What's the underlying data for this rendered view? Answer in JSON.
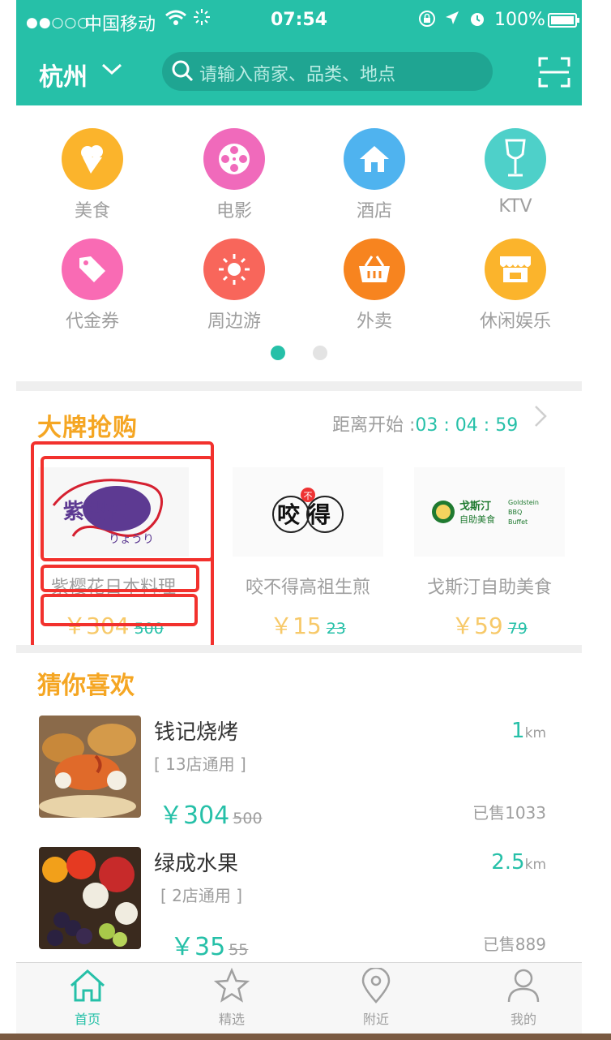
{
  "status_bar": {
    "signal": "●●○○○",
    "carrier": "中国移动",
    "time": "07:54",
    "battery": "100%"
  },
  "header": {
    "city": "杭州",
    "search_placeholder": "请输入商家、品类、地点"
  },
  "categories": [
    {
      "label": "美食",
      "color": "#fbb42c",
      "icon": "ice-cream-icon"
    },
    {
      "label": "电影",
      "color": "#f06abb",
      "icon": "film-reel-icon"
    },
    {
      "label": "酒店",
      "color": "#4fb3ef",
      "icon": "house-icon"
    },
    {
      "label": "KTV",
      "color": "#4ed0c9",
      "icon": "wine-glass-icon"
    },
    {
      "label": "代金券",
      "color": "#f96bb4",
      "icon": "tag-icon"
    },
    {
      "label": "周边游",
      "color": "#f8665b",
      "icon": "sun-icon"
    },
    {
      "label": "外卖",
      "color": "#f7841f",
      "icon": "basket-icon"
    },
    {
      "label": "休闲娱乐",
      "color": "#fbb42c",
      "icon": "shop-icon"
    }
  ],
  "colors": {
    "brand": "#26c0a8",
    "accent_orange": "#f5a623",
    "highlight": "#f2312d"
  },
  "brand_sale": {
    "title": "大牌抢购",
    "countdown_label": "距离开始 :",
    "countdown_time": "03 : 04 : 59",
    "items": [
      {
        "name": "紫樱花日本料理",
        "price": "￥304",
        "old_price": "500",
        "logo_text": "紫樱花",
        "logo_sub": "りょうり"
      },
      {
        "name": "咬不得高祖生煎",
        "price": "￥15",
        "old_price": "23",
        "logo_text": "咬得",
        "logo_sub": "不"
      },
      {
        "name": "戈斯汀自助美食",
        "price": "￥59",
        "old_price": "79",
        "logo_text": "戈斯汀",
        "logo_sub": "自助美食",
        "logo_en1": "Goldstein",
        "logo_en2": "BBQ",
        "logo_en3": "Buffet"
      }
    ]
  },
  "guess": {
    "title": "猜你喜欢",
    "items": [
      {
        "name": "钱记烧烤",
        "stores": "[ 13店通用 ]",
        "price": "￥304",
        "old_price": "500",
        "distance": "1",
        "unit": "km",
        "sold": "已售1033"
      },
      {
        "name": "绿成水果",
        "stores": "[ 2店通用 ]",
        "price": "￥35",
        "old_price": "55",
        "distance": "2.5",
        "unit": "km",
        "sold": "已售889"
      }
    ]
  },
  "tabs": [
    {
      "label": "首页",
      "icon": "home-icon",
      "active": true
    },
    {
      "label": "精选",
      "icon": "star-icon",
      "active": false
    },
    {
      "label": "附近",
      "icon": "location-pin-icon",
      "active": false
    },
    {
      "label": "我的",
      "icon": "user-icon",
      "active": false
    }
  ]
}
